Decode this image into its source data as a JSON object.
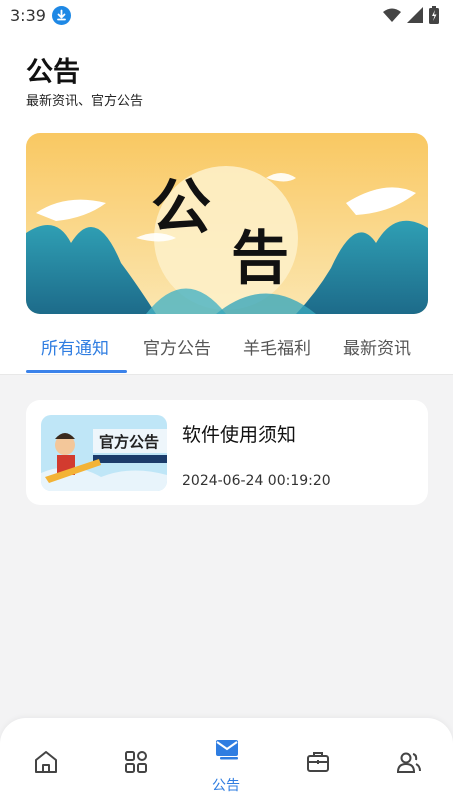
{
  "status_bar": {
    "time": "3:39",
    "download_icon": "download-icon",
    "wifi_icon": "wifi-icon",
    "signal_icon": "signal-icon",
    "battery_icon": "battery-icon"
  },
  "header": {
    "title": "公告",
    "subtitle": "最新资讯、官方公告"
  },
  "banner": {
    "calligraphy_1": "公",
    "calligraphy_2": "告"
  },
  "tabs": [
    {
      "label": "所有通知",
      "active": true
    },
    {
      "label": "官方公告",
      "active": false
    },
    {
      "label": "羊毛福利",
      "active": false
    },
    {
      "label": "最新资讯",
      "active": false
    }
  ],
  "notices": [
    {
      "title": "软件使用须知",
      "time": "2024-06-24 00:19:20",
      "thumb_text": "官方公告"
    }
  ],
  "bottom_nav": [
    {
      "icon": "home-icon",
      "label": ""
    },
    {
      "icon": "grid-icon",
      "label": ""
    },
    {
      "icon": "mail-icon",
      "label": "公告",
      "active": true
    },
    {
      "icon": "briefcase-icon",
      "label": ""
    },
    {
      "icon": "users-icon",
      "label": ""
    }
  ],
  "colors": {
    "accent": "#2f7de1",
    "background": "#f3f3f4"
  }
}
